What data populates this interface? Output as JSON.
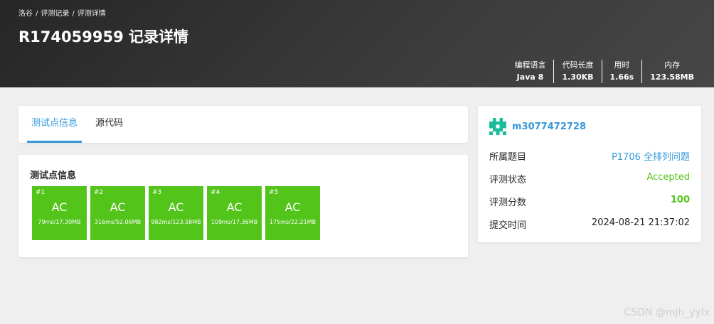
{
  "breadcrumb": {
    "items": [
      "洛谷",
      "评测记录",
      "评测详情"
    ],
    "separator": "/"
  },
  "page_title": "R174059959 记录详情",
  "stats": [
    {
      "label": "编程语言",
      "value": "Java 8"
    },
    {
      "label": "代码长度",
      "value": "1.30KB"
    },
    {
      "label": "用时",
      "value": "1.66s"
    },
    {
      "label": "内存",
      "value": "123.58MB"
    }
  ],
  "tabs": [
    {
      "label": "测试点信息",
      "active": true
    },
    {
      "label": "源代码",
      "active": false
    }
  ],
  "tests_section": {
    "title": "测试点信息",
    "cases": [
      {
        "num": "#1",
        "status": "AC",
        "detail": "79ms/17.30MB"
      },
      {
        "num": "#2",
        "status": "AC",
        "detail": "316ms/52.06MB"
      },
      {
        "num": "#3",
        "status": "AC",
        "detail": "982ms/123.58MB"
      },
      {
        "num": "#4",
        "status": "AC",
        "detail": "109ms/17.36MB"
      },
      {
        "num": "#5",
        "status": "AC",
        "detail": "175ms/22.21MB"
      }
    ]
  },
  "info": {
    "username": "m3077472728",
    "rows": [
      {
        "label": "所属题目",
        "value": "P1706 全排列问题"
      },
      {
        "label": "评测状态",
        "value": "Accepted"
      },
      {
        "label": "评测分数",
        "value": "100"
      },
      {
        "label": "提交时间",
        "value": "2024-08-21 21:37:02"
      }
    ]
  },
  "colors": {
    "accent": "#3498db",
    "accepted": "#52c41a",
    "header_bg": "#2f2f2f"
  },
  "icons": {
    "avatar": "user-avatar-icon"
  },
  "watermark": "CSDN @mjh_yylx"
}
